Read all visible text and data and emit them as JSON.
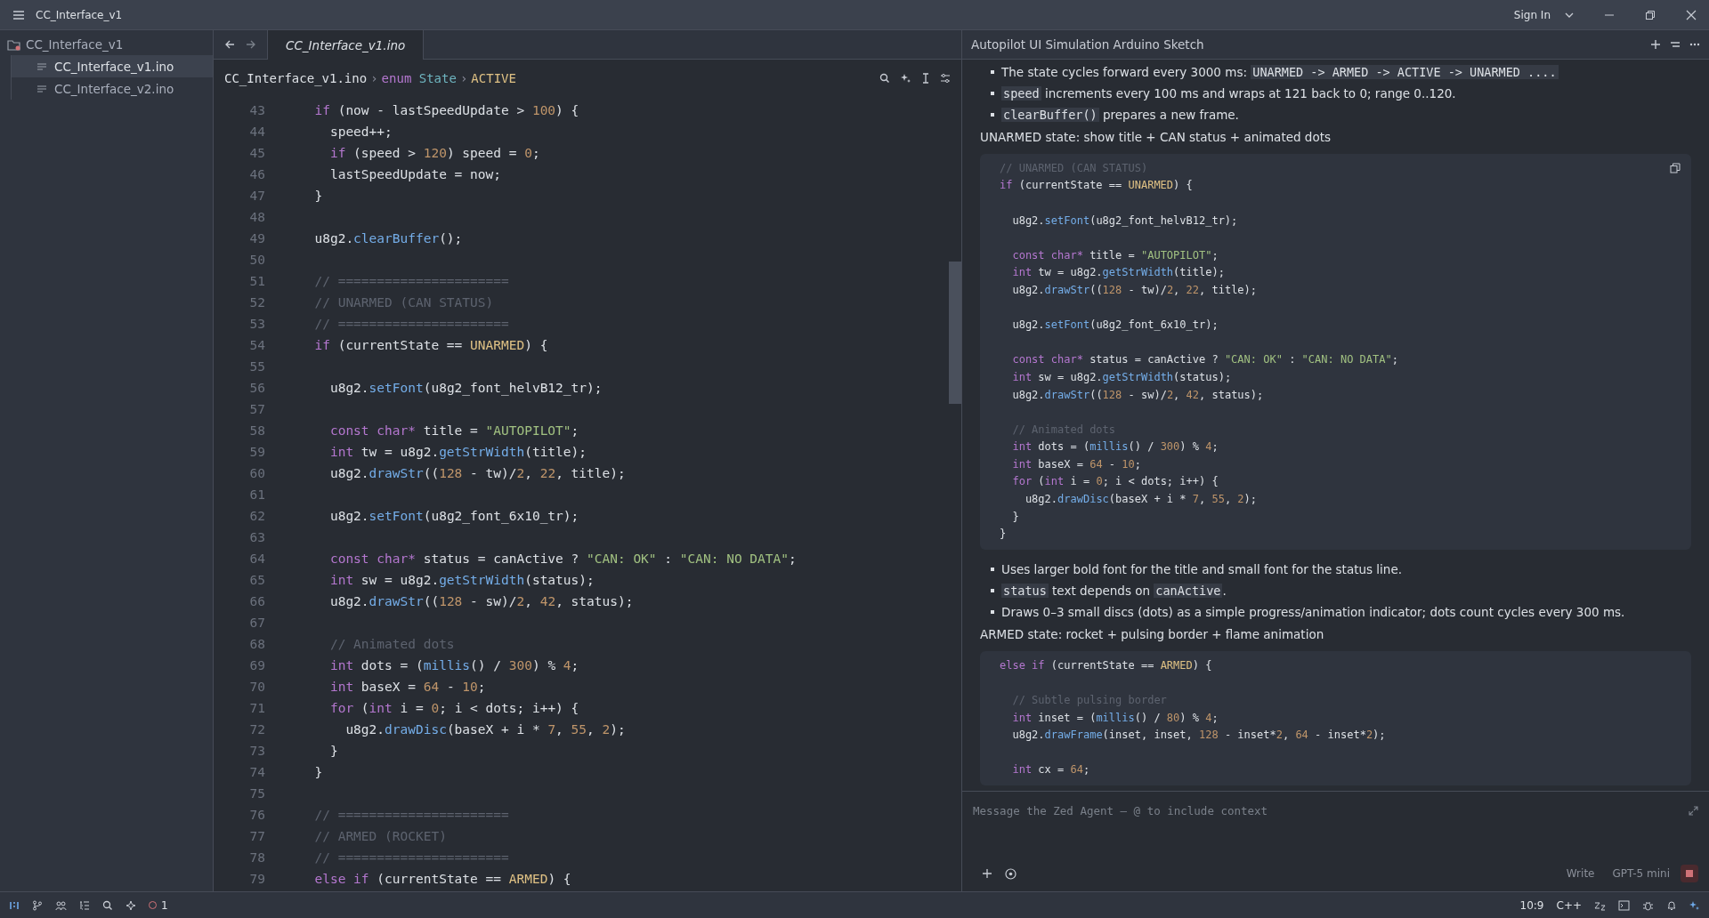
{
  "title_bar": {
    "project": "CC_Interface_v1",
    "sign_in": "Sign In"
  },
  "sidebar": {
    "root": "CC_Interface_v1",
    "files": [
      {
        "name": "CC_Interface_v1.ino",
        "selected": true
      },
      {
        "name": "CC_Interface_v2.ino",
        "selected": false
      }
    ]
  },
  "editor": {
    "tabs": [
      {
        "label": "CC_Interface_v1.ino",
        "selected": true
      }
    ],
    "breadcrumb_separator": "›",
    "breadcrumbs": [
      [
        {
          "kind": "plain",
          "text": "CC_Interface_v1.ino"
        }
      ],
      [
        {
          "kind": "keyword",
          "text": "enum "
        },
        {
          "kind": "type",
          "text": "State"
        }
      ],
      [
        {
          "kind": "constant",
          "text": "ACTIVE"
        }
      ]
    ],
    "lines": [
      {
        "n": "43",
        "s": [
          {
            "kind": "keyword",
            "text": "  if"
          },
          {
            "kind": "plain",
            "text": " (now - lastSpeedUpdate > "
          },
          {
            "kind": "number",
            "text": "100"
          },
          {
            "kind": "plain",
            "text": ") {"
          }
        ]
      },
      {
        "n": "44",
        "s": [
          {
            "kind": "plain",
            "text": "    speed++;"
          }
        ]
      },
      {
        "n": "45",
        "s": [
          {
            "kind": "keyword",
            "text": "    if"
          },
          {
            "kind": "plain",
            "text": " (speed > "
          },
          {
            "kind": "number",
            "text": "120"
          },
          {
            "kind": "plain",
            "text": ") speed = "
          },
          {
            "kind": "number",
            "text": "0"
          },
          {
            "kind": "plain",
            "text": ";"
          }
        ]
      },
      {
        "n": "46",
        "s": [
          {
            "kind": "plain",
            "text": "    lastSpeedUpdate = now;"
          }
        ]
      },
      {
        "n": "47",
        "s": [
          {
            "kind": "plain",
            "text": "  }"
          }
        ]
      },
      {
        "n": "48"
      },
      {
        "n": "49",
        "s": [
          {
            "kind": "plain",
            "text": "  u8g2."
          },
          {
            "kind": "function",
            "text": "clearBuffer"
          },
          {
            "kind": "plain",
            "text": "();"
          }
        ]
      },
      {
        "n": "50"
      },
      {
        "n": "51",
        "s": [
          {
            "kind": "comment",
            "text": "  // ======================"
          }
        ]
      },
      {
        "n": "52",
        "s": [
          {
            "kind": "comment",
            "text": "  // UNARMED (CAN STATUS)"
          }
        ]
      },
      {
        "n": "53",
        "s": [
          {
            "kind": "comment",
            "text": "  // ======================"
          }
        ]
      },
      {
        "n": "54",
        "s": [
          {
            "kind": "keyword",
            "text": "  if"
          },
          {
            "kind": "plain",
            "text": " (currentState == "
          },
          {
            "kind": "constant",
            "text": "UNARMED"
          },
          {
            "kind": "plain",
            "text": ") {"
          }
        ]
      },
      {
        "n": "55"
      },
      {
        "n": "56",
        "s": [
          {
            "kind": "plain",
            "text": "    u8g2."
          },
          {
            "kind": "function",
            "text": "setFont"
          },
          {
            "kind": "plain",
            "text": "(u8g2_font_helvB12_tr);"
          }
        ]
      },
      {
        "n": "57"
      },
      {
        "n": "58",
        "s": [
          {
            "kind": "keyword",
            "text": "    const char*"
          },
          {
            "kind": "plain",
            "text": " title = "
          },
          {
            "kind": "string",
            "text": "\"AUTOPILOT\""
          },
          {
            "kind": "plain",
            "text": ";"
          }
        ]
      },
      {
        "n": "59",
        "s": [
          {
            "kind": "keyword",
            "text": "    int"
          },
          {
            "kind": "plain",
            "text": " tw = u8g2."
          },
          {
            "kind": "function",
            "text": "getStrWidth"
          },
          {
            "kind": "plain",
            "text": "(title);"
          }
        ]
      },
      {
        "n": "60",
        "s": [
          {
            "kind": "plain",
            "text": "    u8g2."
          },
          {
            "kind": "function",
            "text": "drawStr"
          },
          {
            "kind": "plain",
            "text": "(("
          },
          {
            "kind": "number",
            "text": "128"
          },
          {
            "kind": "plain",
            "text": " - tw)/"
          },
          {
            "kind": "number",
            "text": "2"
          },
          {
            "kind": "plain",
            "text": ", "
          },
          {
            "kind": "number",
            "text": "22"
          },
          {
            "kind": "plain",
            "text": ", title);"
          }
        ]
      },
      {
        "n": "61"
      },
      {
        "n": "62",
        "s": [
          {
            "kind": "plain",
            "text": "    u8g2."
          },
          {
            "kind": "function",
            "text": "setFont"
          },
          {
            "kind": "plain",
            "text": "(u8g2_font_6x10_tr);"
          }
        ]
      },
      {
        "n": "63"
      },
      {
        "n": "64",
        "s": [
          {
            "kind": "keyword",
            "text": "    const char*"
          },
          {
            "kind": "plain",
            "text": " status = canActive ? "
          },
          {
            "kind": "string",
            "text": "\"CAN: OK\""
          },
          {
            "kind": "plain",
            "text": " : "
          },
          {
            "kind": "string",
            "text": "\"CAN: NO DATA\""
          },
          {
            "kind": "plain",
            "text": ";"
          }
        ]
      },
      {
        "n": "65",
        "s": [
          {
            "kind": "keyword",
            "text": "    int"
          },
          {
            "kind": "plain",
            "text": " sw = u8g2."
          },
          {
            "kind": "function",
            "text": "getStrWidth"
          },
          {
            "kind": "plain",
            "text": "(status);"
          }
        ]
      },
      {
        "n": "66",
        "s": [
          {
            "kind": "plain",
            "text": "    u8g2."
          },
          {
            "kind": "function",
            "text": "drawStr"
          },
          {
            "kind": "plain",
            "text": "(("
          },
          {
            "kind": "number",
            "text": "128"
          },
          {
            "kind": "plain",
            "text": " - sw)/"
          },
          {
            "kind": "number",
            "text": "2"
          },
          {
            "kind": "plain",
            "text": ", "
          },
          {
            "kind": "number",
            "text": "42"
          },
          {
            "kind": "plain",
            "text": ", status);"
          }
        ]
      },
      {
        "n": "67"
      },
      {
        "n": "68",
        "s": [
          {
            "kind": "comment",
            "text": "    // Animated dots"
          }
        ]
      },
      {
        "n": "69",
        "s": [
          {
            "kind": "keyword",
            "text": "    int"
          },
          {
            "kind": "plain",
            "text": " dots = ("
          },
          {
            "kind": "function",
            "text": "millis"
          },
          {
            "kind": "plain",
            "text": "() / "
          },
          {
            "kind": "number",
            "text": "300"
          },
          {
            "kind": "plain",
            "text": ") % "
          },
          {
            "kind": "number",
            "text": "4"
          },
          {
            "kind": "plain",
            "text": ";"
          }
        ]
      },
      {
        "n": "70",
        "s": [
          {
            "kind": "keyword",
            "text": "    int"
          },
          {
            "kind": "plain",
            "text": " baseX = "
          },
          {
            "kind": "number",
            "text": "64"
          },
          {
            "kind": "plain",
            "text": " - "
          },
          {
            "kind": "number",
            "text": "10"
          },
          {
            "kind": "plain",
            "text": ";"
          }
        ]
      },
      {
        "n": "71",
        "s": [
          {
            "kind": "keyword",
            "text": "    for"
          },
          {
            "kind": "plain",
            "text": " ("
          },
          {
            "kind": "keyword",
            "text": "int"
          },
          {
            "kind": "plain",
            "text": " i = "
          },
          {
            "kind": "number",
            "text": "0"
          },
          {
            "kind": "plain",
            "text": "; i < dots; i++) {"
          }
        ]
      },
      {
        "n": "72",
        "s": [
          {
            "kind": "plain",
            "text": "      u8g2."
          },
          {
            "kind": "function",
            "text": "drawDisc"
          },
          {
            "kind": "plain",
            "text": "(baseX + i * "
          },
          {
            "kind": "number",
            "text": "7"
          },
          {
            "kind": "plain",
            "text": ", "
          },
          {
            "kind": "number",
            "text": "55"
          },
          {
            "kind": "plain",
            "text": ", "
          },
          {
            "kind": "number",
            "text": "2"
          },
          {
            "kind": "plain",
            "text": ");"
          }
        ]
      },
      {
        "n": "73",
        "s": [
          {
            "kind": "plain",
            "text": "    }"
          }
        ]
      },
      {
        "n": "74",
        "s": [
          {
            "kind": "plain",
            "text": "  }"
          }
        ]
      },
      {
        "n": "75"
      },
      {
        "n": "76",
        "s": [
          {
            "kind": "comment",
            "text": "  // ======================"
          }
        ]
      },
      {
        "n": "77",
        "s": [
          {
            "kind": "comment",
            "text": "  // ARMED (ROCKET)"
          }
        ]
      },
      {
        "n": "78",
        "s": [
          {
            "kind": "comment",
            "text": "  // ======================"
          }
        ]
      },
      {
        "n": "79",
        "s": [
          {
            "kind": "keyword",
            "text": "  else if"
          },
          {
            "kind": "plain",
            "text": " (currentState == "
          },
          {
            "kind": "constant",
            "text": "ARMED"
          },
          {
            "kind": "plain",
            "text": ") {"
          }
        ]
      }
    ]
  },
  "agent": {
    "title": "Autopilot UI Simulation Arduino Sketch",
    "blocks": [
      {
        "kind": "bullet",
        "s": [
          {
            "kind": "plain",
            "text": "The state cycles forward every 3000 ms: "
          },
          {
            "kind": "code",
            "text": "UNARMED -> ARMED -> ACTIVE -> UNARMED ...."
          }
        ]
      },
      {
        "kind": "bullet",
        "s": [
          {
            "kind": "code",
            "text": "speed"
          },
          {
            "kind": "plain",
            "text": " increments every 100 ms and wraps at 121 back to 0; range 0..120."
          }
        ]
      },
      {
        "kind": "bullet",
        "s": [
          {
            "kind": "code",
            "text": "clearBuffer()"
          },
          {
            "kind": "plain",
            "text": " prepares a new frame."
          }
        ]
      },
      {
        "kind": "para",
        "s": [
          {
            "kind": "plain",
            "text": "UNARMED state: show title + CAN status + animated dots"
          }
        ]
      },
      {
        "kind": "code",
        "copy": true,
        "lines": [
          {
            "s": [
              {
                "kind": "comment",
                "text": "// UNARMED (CAN STATUS)"
              }
            ]
          },
          {
            "s": [
              {
                "kind": "keyword",
                "text": "if"
              },
              {
                "kind": "plain",
                "text": " (currentState == "
              },
              {
                "kind": "constant",
                "text": "UNARMED"
              },
              {
                "kind": "plain",
                "text": ") {"
              }
            ]
          },
          {
            "blank": true
          },
          {
            "s": [
              {
                "kind": "plain",
                "text": "  u8g2."
              },
              {
                "kind": "function",
                "text": "setFont"
              },
              {
                "kind": "plain",
                "text": "(u8g2_font_helvB12_tr);"
              }
            ]
          },
          {
            "blank": true
          },
          {
            "s": [
              {
                "kind": "keyword",
                "text": "  const char*"
              },
              {
                "kind": "plain",
                "text": " title = "
              },
              {
                "kind": "string",
                "text": "\"AUTOPILOT\""
              },
              {
                "kind": "plain",
                "text": ";"
              }
            ]
          },
          {
            "s": [
              {
                "kind": "keyword",
                "text": "  int"
              },
              {
                "kind": "plain",
                "text": " tw = u8g2."
              },
              {
                "kind": "function",
                "text": "getStrWidth"
              },
              {
                "kind": "plain",
                "text": "(title);"
              }
            ]
          },
          {
            "s": [
              {
                "kind": "plain",
                "text": "  u8g2."
              },
              {
                "kind": "function",
                "text": "drawStr"
              },
              {
                "kind": "plain",
                "text": "(("
              },
              {
                "kind": "number",
                "text": "128"
              },
              {
                "kind": "plain",
                "text": " - tw)/"
              },
              {
                "kind": "number",
                "text": "2"
              },
              {
                "kind": "plain",
                "text": ", "
              },
              {
                "kind": "number",
                "text": "22"
              },
              {
                "kind": "plain",
                "text": ", title);"
              }
            ]
          },
          {
            "blank": true
          },
          {
            "s": [
              {
                "kind": "plain",
                "text": "  u8g2."
              },
              {
                "kind": "function",
                "text": "setFont"
              },
              {
                "kind": "plain",
                "text": "(u8g2_font_6x10_tr);"
              }
            ]
          },
          {
            "blank": true
          },
          {
            "s": [
              {
                "kind": "keyword",
                "text": "  const char*"
              },
              {
                "kind": "plain",
                "text": " status = canActive ? "
              },
              {
                "kind": "string",
                "text": "\"CAN: OK\""
              },
              {
                "kind": "plain",
                "text": " : "
              },
              {
                "kind": "string",
                "text": "\"CAN: NO DATA\""
              },
              {
                "kind": "plain",
                "text": ";"
              }
            ]
          },
          {
            "s": [
              {
                "kind": "keyword",
                "text": "  int"
              },
              {
                "kind": "plain",
                "text": " sw = u8g2."
              },
              {
                "kind": "function",
                "text": "getStrWidth"
              },
              {
                "kind": "plain",
                "text": "(status);"
              }
            ]
          },
          {
            "s": [
              {
                "kind": "plain",
                "text": "  u8g2."
              },
              {
                "kind": "function",
                "text": "drawStr"
              },
              {
                "kind": "plain",
                "text": "(("
              },
              {
                "kind": "number",
                "text": "128"
              },
              {
                "kind": "plain",
                "text": " - sw)/"
              },
              {
                "kind": "number",
                "text": "2"
              },
              {
                "kind": "plain",
                "text": ", "
              },
              {
                "kind": "number",
                "text": "42"
              },
              {
                "kind": "plain",
                "text": ", status);"
              }
            ]
          },
          {
            "blank": true
          },
          {
            "s": [
              {
                "kind": "comment",
                "text": "  // Animated dots"
              }
            ]
          },
          {
            "s": [
              {
                "kind": "keyword",
                "text": "  int"
              },
              {
                "kind": "plain",
                "text": " dots = ("
              },
              {
                "kind": "function",
                "text": "millis"
              },
              {
                "kind": "plain",
                "text": "() / "
              },
              {
                "kind": "number",
                "text": "300"
              },
              {
                "kind": "plain",
                "text": ") % "
              },
              {
                "kind": "number",
                "text": "4"
              },
              {
                "kind": "plain",
                "text": ";"
              }
            ]
          },
          {
            "s": [
              {
                "kind": "keyword",
                "text": "  int"
              },
              {
                "kind": "plain",
                "text": " baseX = "
              },
              {
                "kind": "number",
                "text": "64"
              },
              {
                "kind": "plain",
                "text": " - "
              },
              {
                "kind": "number",
                "text": "10"
              },
              {
                "kind": "plain",
                "text": ";"
              }
            ]
          },
          {
            "s": [
              {
                "kind": "keyword",
                "text": "  for"
              },
              {
                "kind": "plain",
                "text": " ("
              },
              {
                "kind": "keyword",
                "text": "int"
              },
              {
                "kind": "plain",
                "text": " i = "
              },
              {
                "kind": "number",
                "text": "0"
              },
              {
                "kind": "plain",
                "text": "; i < dots; i++) {"
              }
            ]
          },
          {
            "s": [
              {
                "kind": "plain",
                "text": "    u8g2."
              },
              {
                "kind": "function",
                "text": "drawDisc"
              },
              {
                "kind": "plain",
                "text": "(baseX + i * "
              },
              {
                "kind": "number",
                "text": "7"
              },
              {
                "kind": "plain",
                "text": ", "
              },
              {
                "kind": "number",
                "text": "55"
              },
              {
                "kind": "plain",
                "text": ", "
              },
              {
                "kind": "number",
                "text": "2"
              },
              {
                "kind": "plain",
                "text": ");"
              }
            ]
          },
          {
            "s": [
              {
                "kind": "plain",
                "text": "  }"
              }
            ]
          },
          {
            "s": [
              {
                "kind": "plain",
                "text": "}"
              }
            ]
          }
        ]
      },
      {
        "kind": "bullet",
        "s": [
          {
            "kind": "plain",
            "text": "Uses larger bold font for the title and small font for the status line."
          }
        ]
      },
      {
        "kind": "bullet",
        "s": [
          {
            "kind": "code",
            "text": "status"
          },
          {
            "kind": "plain",
            "text": " text depends on "
          },
          {
            "kind": "code",
            "text": "canActive"
          },
          {
            "kind": "plain",
            "text": "."
          }
        ]
      },
      {
        "kind": "bullet",
        "s": [
          {
            "kind": "plain",
            "text": "Draws 0–3 small discs (dots) as a simple progress/animation indicator; dots count cycles every 300 ms."
          }
        ]
      },
      {
        "kind": "para",
        "s": [
          {
            "kind": "plain",
            "text": "ARMED state: rocket + pulsing border + flame animation"
          }
        ]
      },
      {
        "kind": "code",
        "copy": false,
        "lines": [
          {
            "s": [
              {
                "kind": "keyword",
                "text": "else if"
              },
              {
                "kind": "plain",
                "text": " (currentState == "
              },
              {
                "kind": "constant",
                "text": "ARMED"
              },
              {
                "kind": "plain",
                "text": ") {"
              }
            ]
          },
          {
            "blank": true
          },
          {
            "s": [
              {
                "kind": "comment",
                "text": "  // Subtle pulsing border"
              }
            ]
          },
          {
            "s": [
              {
                "kind": "keyword",
                "text": "  int"
              },
              {
                "kind": "plain",
                "text": " inset = ("
              },
              {
                "kind": "function",
                "text": "millis"
              },
              {
                "kind": "plain",
                "text": "() / "
              },
              {
                "kind": "number",
                "text": "80"
              },
              {
                "kind": "plain",
                "text": ") % "
              },
              {
                "kind": "number",
                "text": "4"
              },
              {
                "kind": "plain",
                "text": ";"
              }
            ]
          },
          {
            "s": [
              {
                "kind": "plain",
                "text": "  u8g2."
              },
              {
                "kind": "function",
                "text": "drawFrame"
              },
              {
                "kind": "plain",
                "text": "(inset, inset, "
              },
              {
                "kind": "number",
                "text": "128"
              },
              {
                "kind": "plain",
                "text": " - inset*"
              },
              {
                "kind": "number",
                "text": "2"
              },
              {
                "kind": "plain",
                "text": ", "
              },
              {
                "kind": "number",
                "text": "64"
              },
              {
                "kind": "plain",
                "text": " - inset*"
              },
              {
                "kind": "number",
                "text": "2"
              },
              {
                "kind": "plain",
                "text": ");"
              }
            ]
          },
          {
            "blank": true
          },
          {
            "s": [
              {
                "kind": "keyword",
                "text": "  int"
              },
              {
                "kind": "plain",
                "text": " cx = "
              },
              {
                "kind": "number",
                "text": "64"
              },
              {
                "kind": "plain",
                "text": ";"
              }
            ]
          }
        ]
      }
    ],
    "input": {
      "placeholder": "Message the Zed Agent — @ to include context"
    },
    "mode": "Write",
    "model": "GPT-5 mini"
  },
  "status_bar": {
    "errors": "1",
    "cursor": "10:9",
    "language": "C++"
  }
}
